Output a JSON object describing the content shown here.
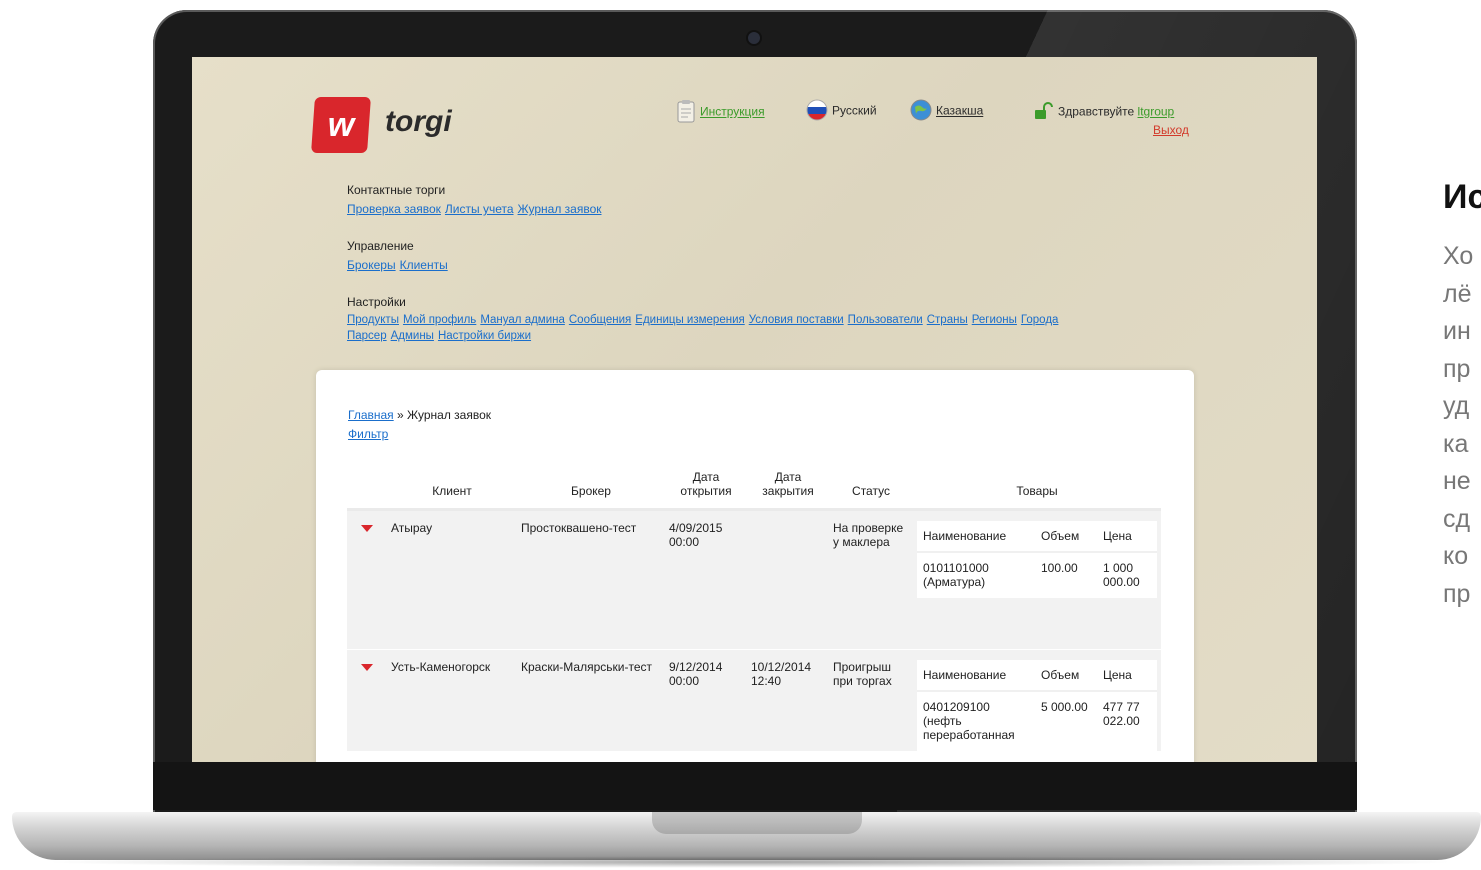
{
  "header": {
    "logo_letter": "w",
    "logo_text": "torgi",
    "instructions": "Инструкция",
    "lang_ru": "Русский",
    "lang_kz": "Казакша",
    "greeting": "Здравствуйте",
    "username": "ltgroup",
    "logout": "Выход"
  },
  "menu": {
    "sections": [
      {
        "title": "Контактные торги",
        "links": [
          "Проверка заявок",
          "Листы учета",
          "Журнал заявок"
        ]
      },
      {
        "title": "Управление",
        "links": [
          "Брокеры",
          "Клиенты"
        ]
      },
      {
        "title": "Настройки",
        "links": [
          "Продукты",
          "Мой профиль",
          "Мануал админа",
          "Сообщения",
          "Единицы измерения",
          "Условия поставки",
          "Пользователи",
          "Страны",
          "Регионы",
          "Города"
        ],
        "links2": [
          "Парсер",
          "Админы",
          "Настройки биржи"
        ]
      }
    ]
  },
  "breadcrumb": {
    "home": "Главная",
    "sep": " » ",
    "current": "Журнал заявок"
  },
  "filter": "Фильтр",
  "table": {
    "headers": {
      "client": "Клиент",
      "broker": "Брокер",
      "opened": "Дата открытия",
      "closed": "Дата закрытия",
      "status": "Статус",
      "goods": "Товары"
    },
    "goods_headers": {
      "name": "Наименование",
      "volume": "Объем",
      "price": "Цена"
    },
    "rows": [
      {
        "client": "Атырау",
        "broker": "Простоквашено-тест",
        "opened": "4/09/2015 00:00",
        "closed": "",
        "status": "На проверке у маклера",
        "goods_name": "0101101000 (Арматура)",
        "goods_volume": "100.00",
        "goods_price": "1 000 000.00"
      },
      {
        "client": "Усть-Каменогорск",
        "broker": "Краски-Малярськи-тест",
        "opened": "9/12/2014 00:00",
        "closed": "10/12/2014 12:40",
        "status": "Проигрыш при торгах",
        "goods_name": "0401209100 (нефть переработанная",
        "goods_volume": "5 000.00",
        "goods_price": "477 77 022.00"
      }
    ]
  },
  "side": {
    "title": "Ис",
    "lines": [
      "Хо",
      "лё",
      "ин",
      "пр",
      "уд",
      "ка",
      "не",
      "сд",
      "ко",
      "пр"
    ]
  },
  "colors": {
    "brand_red": "#d9262c",
    "link_blue": "#1a6ecb",
    "screen_bg": "#e3dcc7"
  }
}
